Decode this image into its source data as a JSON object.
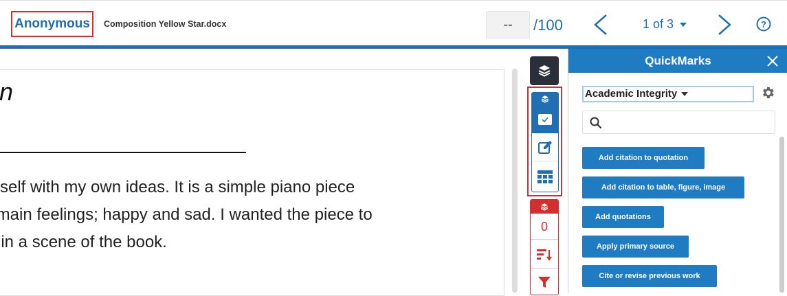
{
  "header": {
    "author": "Anonymous",
    "document_title": "Composition Yellow Star.docx",
    "grade_value": "--",
    "grade_max": "/100",
    "page_indicator": "1 of 3"
  },
  "document": {
    "heading_fragment": "on",
    "paragraph_lines": [
      "yself with my own ideas. It is a simple piano piece",
      " main feelings; happy and sad. I wanted the piece to",
      "t in a scene of the book."
    ]
  },
  "toolbar": {
    "flag_count": "0"
  },
  "quickmarks": {
    "title": "QuickMarks",
    "set_name": "Academic Integrity",
    "search_placeholder": "",
    "marks": [
      "Add citation to quotation",
      "Add citation to table, figure, image",
      "Add quotations",
      "Apply primary source",
      "Cite or revise previous work"
    ]
  },
  "colors": {
    "brand_blue": "#1f6fb2",
    "quickmarks_blue": "#1f7cc2",
    "highlight_red": "#d32f2f",
    "dark_tool": "#2b2f3a"
  },
  "icons": [
    "chevron-left-icon",
    "chevron-right-icon",
    "help-icon",
    "layers-icon",
    "checkbox-icon",
    "edit-icon",
    "grid-icon",
    "sort-icon",
    "filter-icon",
    "close-icon",
    "gear-icon",
    "search-icon"
  ]
}
